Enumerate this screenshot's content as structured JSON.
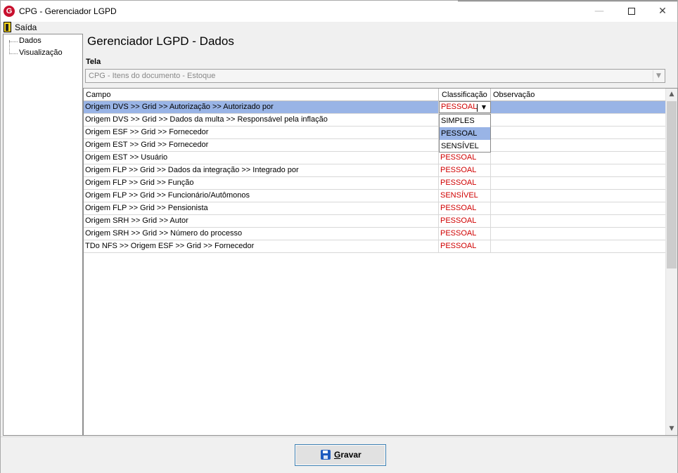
{
  "window": {
    "title": "CPG - Gerenciador LGPD",
    "app_icon_letter": "G",
    "minimize_glyph": "—",
    "close_glyph": "✕"
  },
  "menu": {
    "exit_label": "Saída"
  },
  "tree": {
    "items": [
      {
        "label": "Dados"
      },
      {
        "label": "Visualização"
      }
    ]
  },
  "main": {
    "title": "Gerenciador LGPD - Dados",
    "screen_field_label": "Tela",
    "screen_field_value": "CPG - Itens do documento - Estoque"
  },
  "grid": {
    "columns": [
      "Campo",
      "Classificação",
      "Observação"
    ],
    "rows": [
      {
        "campo": "Origem DVS >> Grid >> Autorização >> Autorizado por",
        "classificacao": "PESSOAL",
        "observacao": ""
      },
      {
        "campo": "Origem DVS >> Grid >> Dados da multa >> Responsável pela inflação",
        "classificacao": "",
        "observacao": ""
      },
      {
        "campo": "Origem ESF >> Grid >> Fornecedor",
        "classificacao": "",
        "observacao": ""
      },
      {
        "campo": "Origem EST >> Grid >> Fornecedor",
        "classificacao": "",
        "observacao": ""
      },
      {
        "campo": "Origem EST >> Usuário",
        "classificacao": "PESSOAL",
        "observacao": ""
      },
      {
        "campo": "Origem FLP >> Grid >> Dados da integração >> Integrado por",
        "classificacao": "PESSOAL",
        "observacao": ""
      },
      {
        "campo": "Origem FLP >> Grid >> Função",
        "classificacao": "PESSOAL",
        "observacao": ""
      },
      {
        "campo": "Origem FLP >> Grid >> Funcionário/Autômonos",
        "classificacao": "SENSÍVEL",
        "observacao": ""
      },
      {
        "campo": "Origem FLP >> Grid >> Pensionista",
        "classificacao": "PESSOAL",
        "observacao": ""
      },
      {
        "campo": "Origem SRH >> Grid >> Autor",
        "classificacao": "PESSOAL",
        "observacao": ""
      },
      {
        "campo": "Origem SRH >> Grid >> Número do processo",
        "classificacao": "PESSOAL",
        "observacao": ""
      },
      {
        "campo": "TDo NFS >> Origem ESF >> Grid >> Fornecedor",
        "classificacao": "PESSOAL",
        "observacao": ""
      }
    ],
    "selected_row": 0,
    "dropdown_options": [
      "SIMPLES",
      "PESSOAL",
      "SENSÍVEL"
    ],
    "dropdown_selected": "PESSOAL"
  },
  "footer": {
    "save_label_first": "G",
    "save_label_rest": "ravar"
  },
  "colors": {
    "selection": "#99b4e6",
    "classification_text": "#d00000",
    "save_icon": "#1e5bbf"
  }
}
